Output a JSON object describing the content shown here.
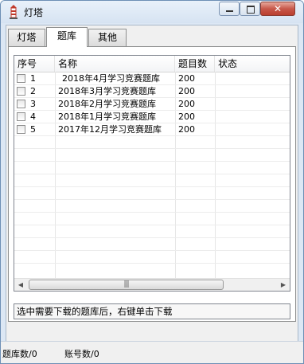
{
  "window": {
    "title": "灯塔"
  },
  "tabs": [
    {
      "label": "灯塔",
      "active": false
    },
    {
      "label": "题库",
      "active": true
    },
    {
      "label": "其他",
      "active": false
    }
  ],
  "table": {
    "columns": [
      "序号",
      "名称",
      "题目数",
      "状态"
    ],
    "rows": [
      {
        "no": "1",
        "name": "2018年4月学习竞赛题库",
        "count": "200",
        "status": "",
        "checked": false
      },
      {
        "no": "2",
        "name": "2018年3月学习竞赛题库",
        "count": "200",
        "status": "",
        "checked": false
      },
      {
        "no": "3",
        "name": "2018年2月学习竞赛题库",
        "count": "200",
        "status": "",
        "checked": false
      },
      {
        "no": "4",
        "name": "2018年1月学习竞赛题库",
        "count": "200",
        "status": "",
        "checked": false
      },
      {
        "no": "5",
        "name": "2017年12月学习竞赛题库",
        "count": "200",
        "status": "",
        "checked": false
      }
    ]
  },
  "scrollbar": {
    "grip": "|||"
  },
  "hint": {
    "text": "选中需要下载的题库后，右键单击下载"
  },
  "status": {
    "bank_count": "题库数/0",
    "account_count": "账号数/0"
  },
  "colors": {
    "accent": "#6d8fb5",
    "close_button": "#c8584a"
  }
}
